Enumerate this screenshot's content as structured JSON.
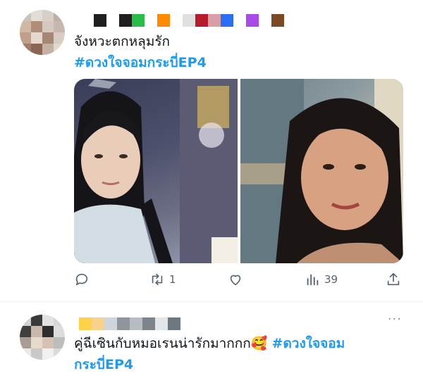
{
  "tweet1": {
    "text": "จังหวะตกหลุมรัก",
    "hashtag": "#ดวงใจจอมกระบี่EP4",
    "name_swatches": [
      "#ffffff",
      "#1f1f1f",
      "#ffffff",
      "#1f1f1f",
      "#2bbd4a",
      "#ffffff",
      "#ff8c00",
      "#ffffff",
      "#e0e0e0",
      "#b51c2c",
      "#d89fa6",
      "#2a6ef5",
      "#ffffff",
      "#a84be8",
      "#ffffff",
      "#7a4a23"
    ],
    "media_images": [
      "actor-in-light-robe",
      "actress-smiling"
    ],
    "actions": {
      "reply": {
        "icon": "reply-icon",
        "count": ""
      },
      "retweet": {
        "icon": "retweet-icon",
        "count": "1"
      },
      "like": {
        "icon": "heart-icon",
        "count": ""
      },
      "views": {
        "icon": "views-icon",
        "count": "39"
      },
      "share": {
        "icon": "share-icon",
        "count": ""
      }
    }
  },
  "tweet2": {
    "text_part1": "คู่ฉีเซินกับหมอเรนน่ารักมากกก",
    "emoji": "🥰",
    "hashtag_line1": "#ดวงใจจอม",
    "hashtag_line2": "กระบี่EP4",
    "more_label": "···",
    "name_swatches": [
      "#ffd24a",
      "#f6d28c",
      "#cfd5db",
      "#8e969d",
      "#b7bcc2",
      "#7c848c",
      "#e3e6e9",
      "#6e7880"
    ]
  },
  "colors": {
    "hashtag": "#1d9bf0",
    "action_gray": "#536471",
    "divider": "#eff3f4"
  }
}
